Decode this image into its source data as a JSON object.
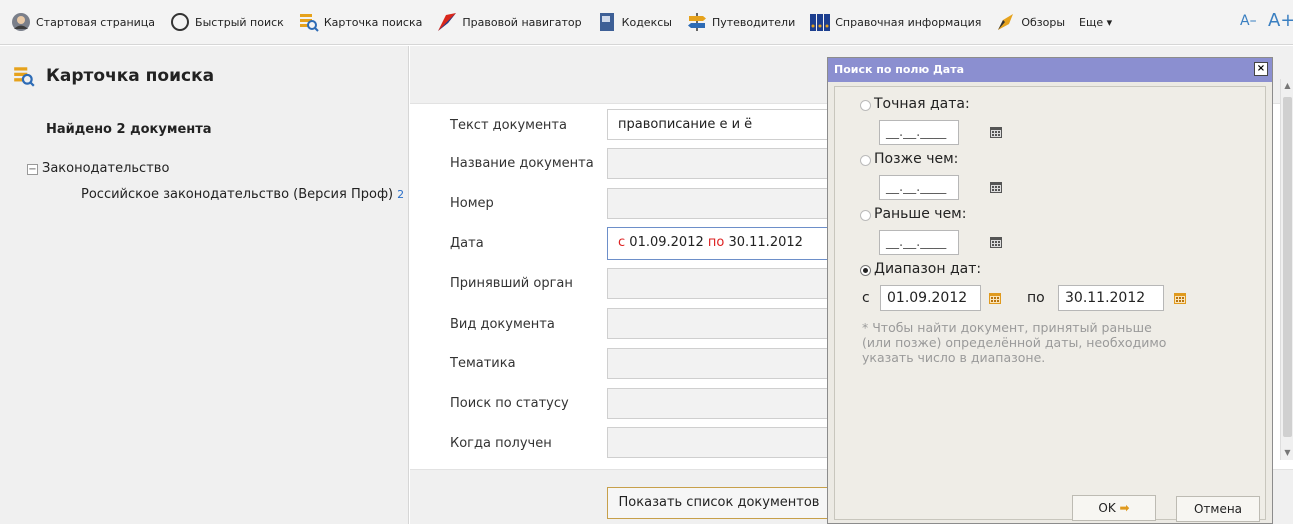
{
  "toolbar": {
    "items": [
      {
        "label": "Стартовая страница",
        "icon": "avatar-icon"
      },
      {
        "label": "Быстрый поиск",
        "icon": "search-circle-icon"
      },
      {
        "label": "Карточка поиска",
        "icon": "search-card-icon"
      },
      {
        "label": "Правовой навигатор",
        "icon": "navigator-icon"
      },
      {
        "label": "Кодексы",
        "icon": "codex-icon"
      },
      {
        "label": "Путеводители",
        "icon": "signpost-icon"
      },
      {
        "label": "Справочная информация",
        "icon": "binders-icon"
      },
      {
        "label": "Обзоры",
        "icon": "pen-icon"
      }
    ],
    "more_label": "Еще ▾",
    "font_decrease": "A–",
    "font_increase": "A+"
  },
  "left_panel": {
    "title": "Карточка поиска",
    "found_text": "Найдено 2 документа",
    "tree_toggle": "−",
    "tree_root": "Законодательство",
    "tree_leaf": "Российское законодательство (Версия Проф)",
    "tree_leaf_count": "2"
  },
  "form": {
    "rows": [
      {
        "label": "Текст документа",
        "value": "правописание е и ё"
      },
      {
        "label": "Название документа",
        "value": ""
      },
      {
        "label": "Номер",
        "value": ""
      },
      {
        "label": "Дата",
        "value": ""
      },
      {
        "label": "Принявший орган",
        "value": ""
      },
      {
        "label": "Вид документа",
        "value": ""
      },
      {
        "label": "Тематика",
        "value": ""
      },
      {
        "label": "Поиск по статусу",
        "value": ""
      },
      {
        "label": "Когда получен",
        "value": ""
      }
    ],
    "date_value": {
      "from_prefix": "с",
      "from": "01.09.2012",
      "to_prefix": "по",
      "to": "30.11.2012"
    },
    "show_button": "Показать список документов"
  },
  "dialog": {
    "title": "Поиск по полю Дата",
    "close": "×",
    "options": [
      {
        "label": "Точная дата:",
        "selected": false,
        "placeholder": "__.__.____"
      },
      {
        "label": "Позже чем:",
        "selected": false,
        "placeholder": "__.__.____"
      },
      {
        "label": "Раньше чем:",
        "selected": false,
        "placeholder": "__.__.____"
      },
      {
        "label": "Диапазон дат:",
        "selected": true
      }
    ],
    "range": {
      "from_label": "с",
      "from_value": "01.09.2012",
      "to_label": "по",
      "to_value": "30.11.2012"
    },
    "note": "* Чтобы найти документ, принятый раньше (или позже) определённой даты, необходимо указать число в диапазоне.",
    "ok_label": "OK",
    "ok_arrow": "➡",
    "cancel_label": "Отмена"
  }
}
